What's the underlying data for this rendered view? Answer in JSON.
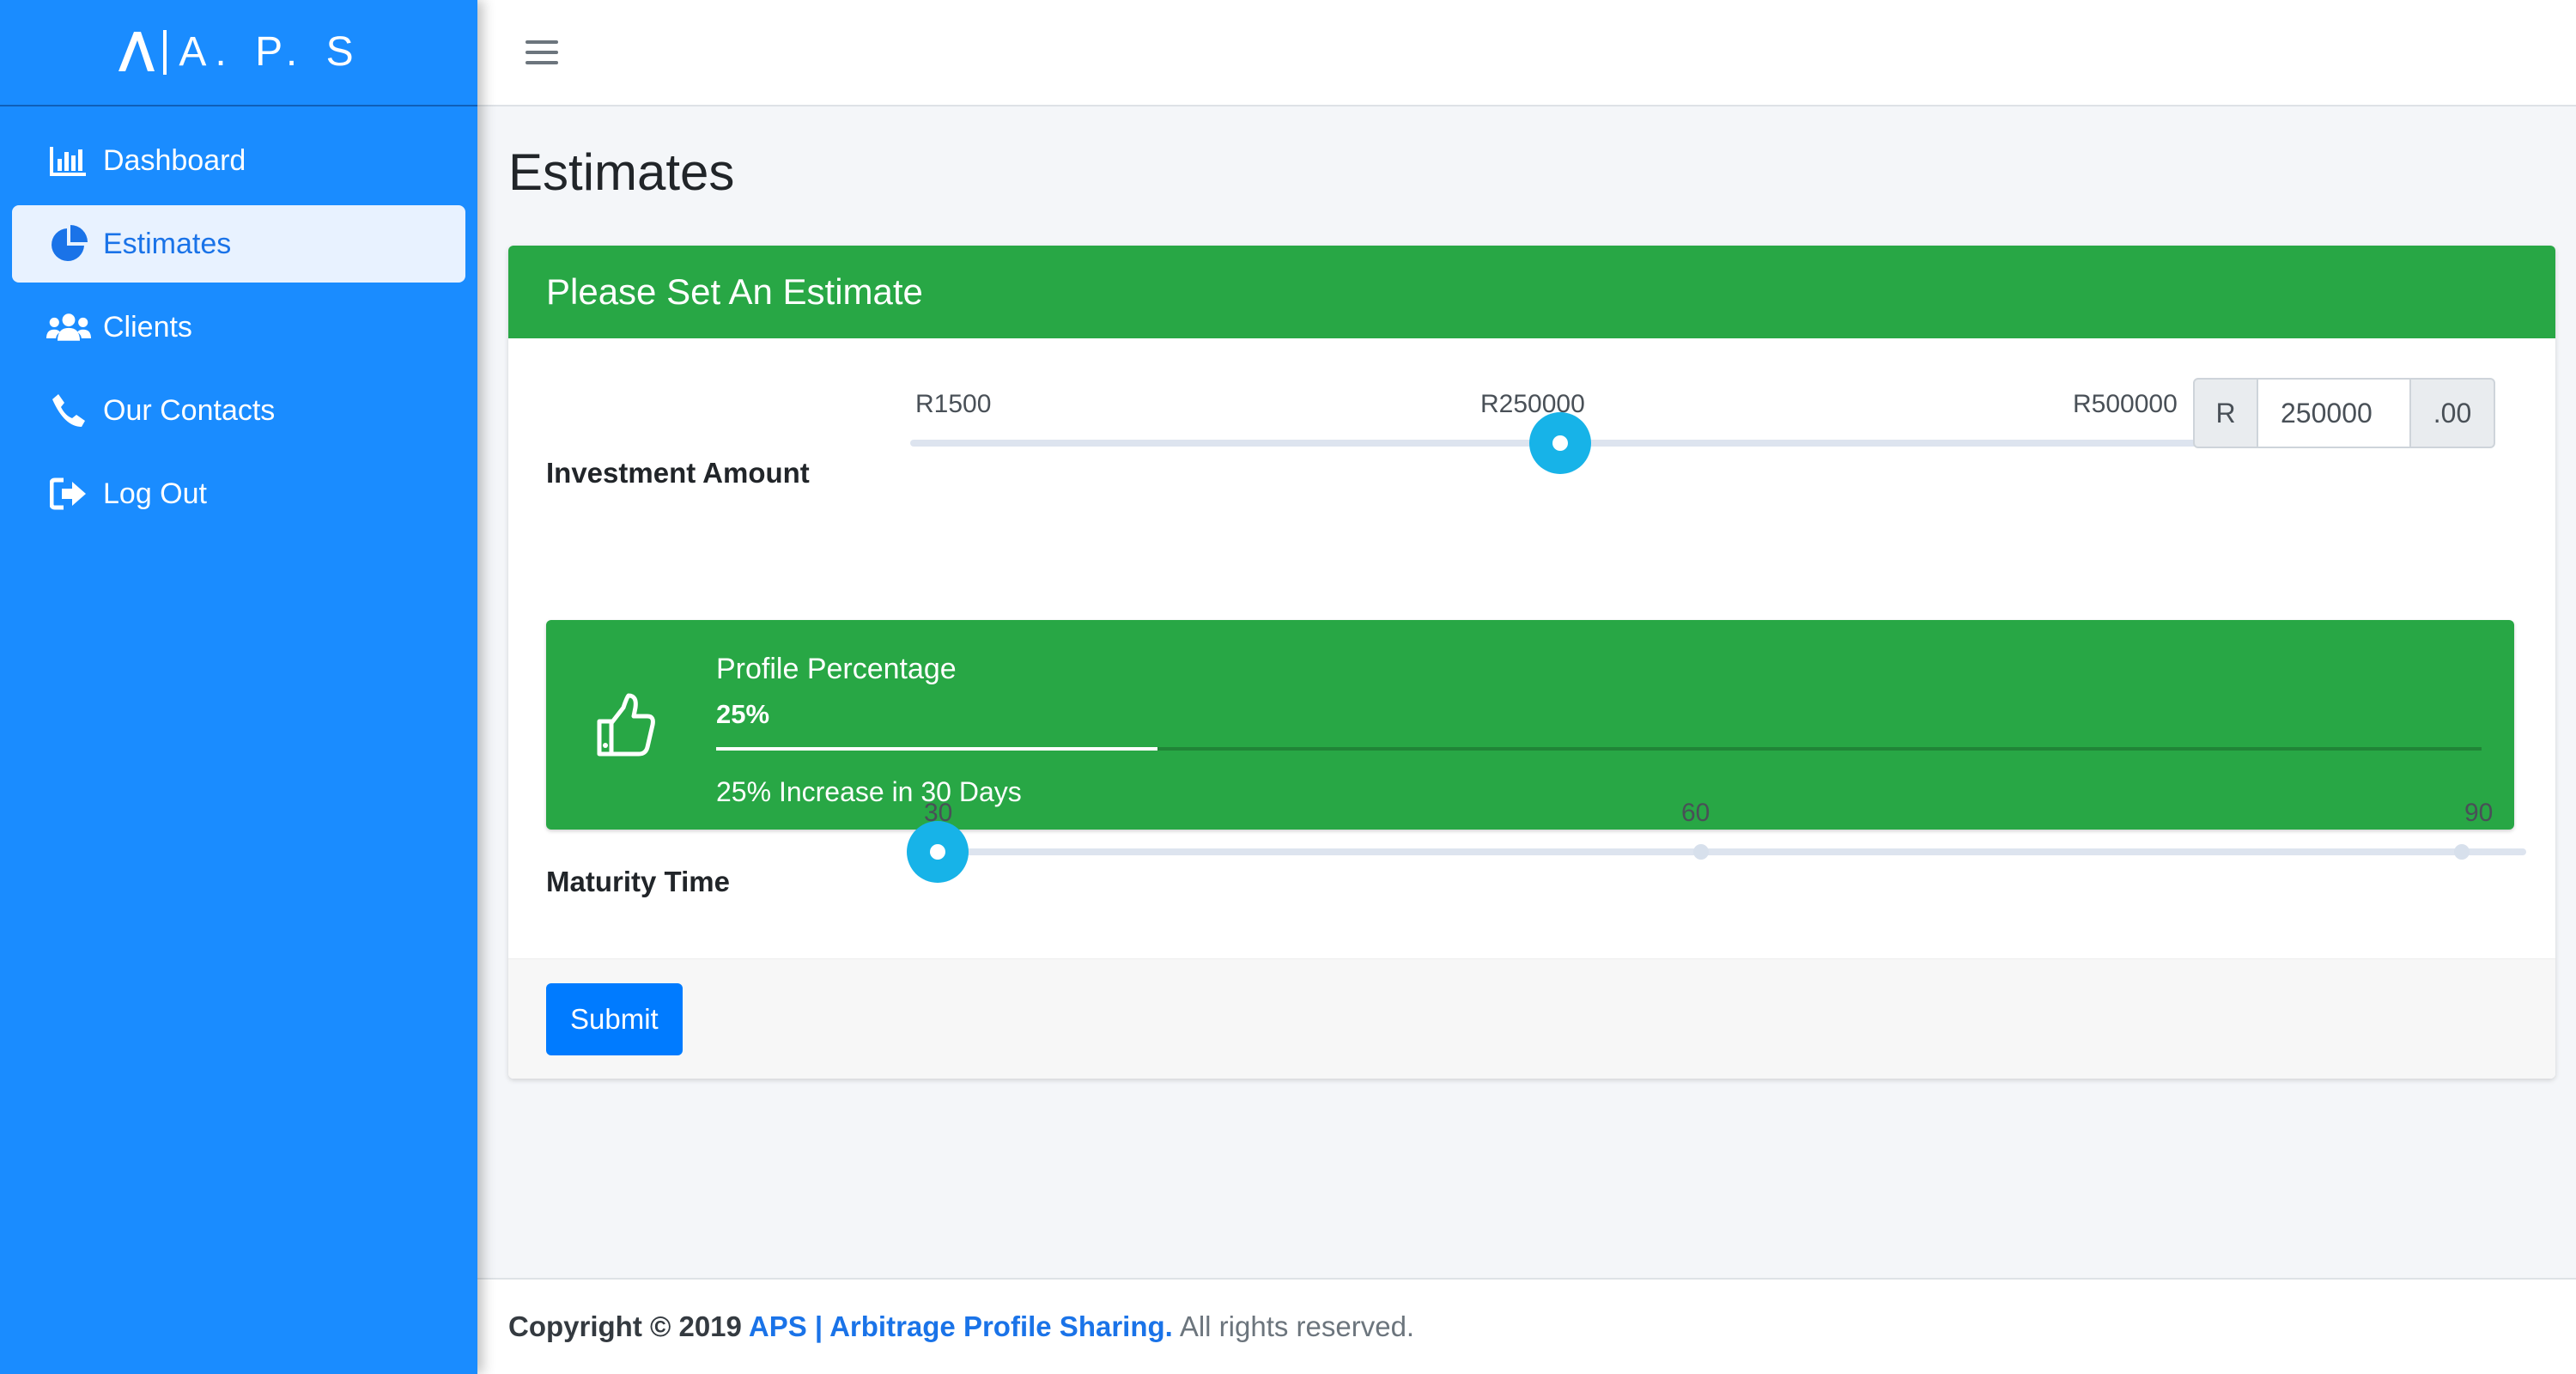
{
  "brand": {
    "text": "A. P. S"
  },
  "sidebar": {
    "items": [
      {
        "label": "Dashboard",
        "icon": "bar-chart-icon",
        "active": false
      },
      {
        "label": "Estimates",
        "icon": "pie-chart-icon",
        "active": true
      },
      {
        "label": "Clients",
        "icon": "users-icon",
        "active": false
      },
      {
        "label": "Our Contacts",
        "icon": "phone-icon",
        "active": false
      },
      {
        "label": "Log Out",
        "icon": "sign-out-icon",
        "active": false
      }
    ]
  },
  "header": {
    "menu_icon": "hamburger-icon"
  },
  "page": {
    "title": "Estimates"
  },
  "card": {
    "header": "Please Set An Estimate",
    "investment": {
      "label": "Investment Amount",
      "min_label": "R1500",
      "current_label": "R250000",
      "max_label": "R500000",
      "min": 1500,
      "max": 500000,
      "value": 250000,
      "currency_prefix": "R",
      "input_value": "250000",
      "suffix": ".00"
    },
    "profile": {
      "title": "Profile Percentage",
      "number": "25%",
      "progress_percent": 25,
      "description": "25% Increase in 30 Days",
      "icon": "thumbs-up-icon"
    },
    "maturity": {
      "label": "Maturity Time",
      "ticks": [
        "30",
        "60",
        "90"
      ],
      "value": 30
    },
    "submit_label": "Submit"
  },
  "footer": {
    "copyright": "Copyright © 2019",
    "brand_link": "APS | Arbitrage Profile Sharing.",
    "rest": "All rights reserved."
  },
  "colors": {
    "sidebar": "#1a8cff",
    "success": "#28a745",
    "primary": "#007bff",
    "slider_thumb": "#17b3e8"
  }
}
